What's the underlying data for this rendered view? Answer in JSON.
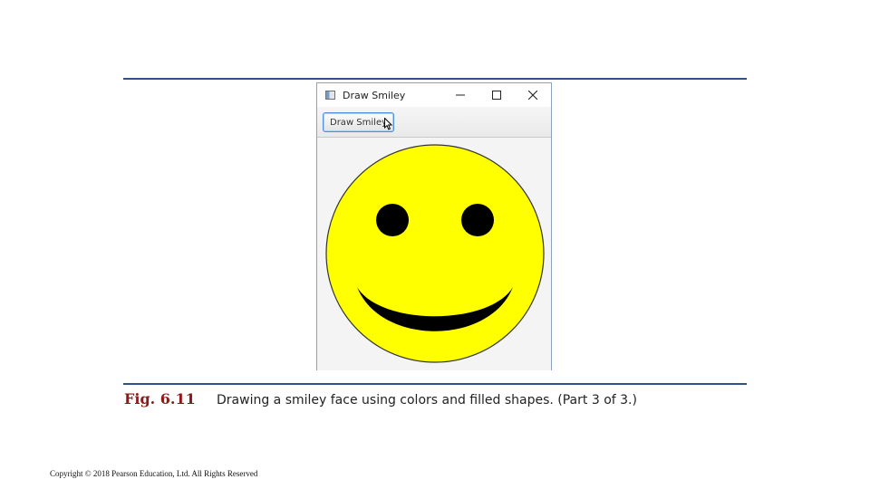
{
  "slide": {
    "figure_label": "Fig. 6.11",
    "caption": "Drawing a smiley face using colors and filled shapes. (Part 3 of 3.)",
    "copyright": "Copyright © 2018 Pearson Education, Ltd. All Rights Reserved",
    "rule_color": "#2f4f8f",
    "figure_label_color": "#8b1a1a"
  },
  "window": {
    "title": "Draw Smiley",
    "controls": {
      "minimize": "minimize-icon",
      "maximize": "maximize-icon",
      "close": "close-icon"
    },
    "toolbar": {
      "draw_button_label": "Draw Smiley"
    }
  },
  "drawing": {
    "face_color": "#ffff00",
    "feature_color": "#000000",
    "background_color": "#f4f4f4"
  }
}
